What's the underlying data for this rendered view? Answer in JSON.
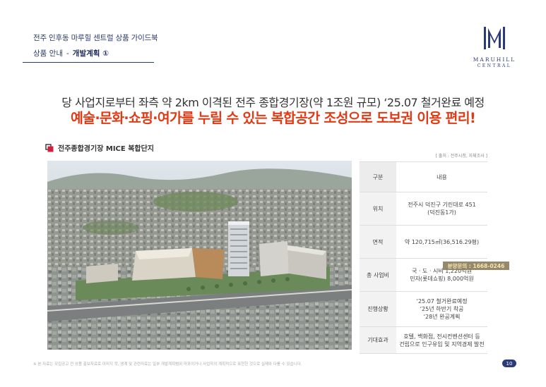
{
  "header": {
    "subtitle": "전주 인후동 마루힐 센트럴 상품 가이드북",
    "crumb_parent": "상품 안내",
    "crumb_sep": "-",
    "crumb_current": "개발계획 ①"
  },
  "logo": {
    "name": "MARUHILL",
    "sub": "CENTRAL"
  },
  "headline": "당 사업지로부터 좌측 약 2km 이격된 전주 종합경기장(약 1조원 규모) ‘25.07 철거완료 예정",
  "subheadline": "예술·문화·쇼핑·여가를 누릴 수 있는 복합공간 조성으로 도보권 이용 편리!",
  "section": {
    "title": "전주종합경기장 MICE 복합단지",
    "source": "[ 출처 : 전주시청, 자체조사 ]"
  },
  "table": {
    "rows": [
      {
        "label": "구분",
        "lines": [
          "내용"
        ]
      },
      {
        "label": "위치",
        "lines": [
          "전주시 덕진구 기린대로 451",
          "(덕진동1가)"
        ]
      },
      {
        "label": "면적",
        "lines": [
          "약 120,715㎡(36,516.29평)"
        ]
      },
      {
        "label": "총 사업비",
        "lines": [
          "국 · 도 · 시비 1,220억원",
          "민자(롯데쇼핑) 8,000억원"
        ]
      },
      {
        "label": "진행상황",
        "lines": [
          "‘25.07 철거완료예정",
          "‘25년 하반기 착공",
          "‘28년 완공계획"
        ]
      },
      {
        "label": "기대효과",
        "lines": [
          "호텔, 백화점, 전시컨벤션센터 등",
          "건립으로 인구유입 및 지역경제 발전"
        ]
      }
    ]
  },
  "tel_badge": "분양문의 : 1668-0246",
  "footnote": "※ 본 자료는 모집공고 전 상품 홍보자료로 이미지 컷, 생계 및 관련자료는 일부 개발계획범위 마포이거나 사업자의 계획적으로 표현한 것으로 실제와 다를 수 있습니다.",
  "page_number": "10",
  "colors": {
    "navy": "#2b3a78",
    "accent": "#e13a14"
  }
}
